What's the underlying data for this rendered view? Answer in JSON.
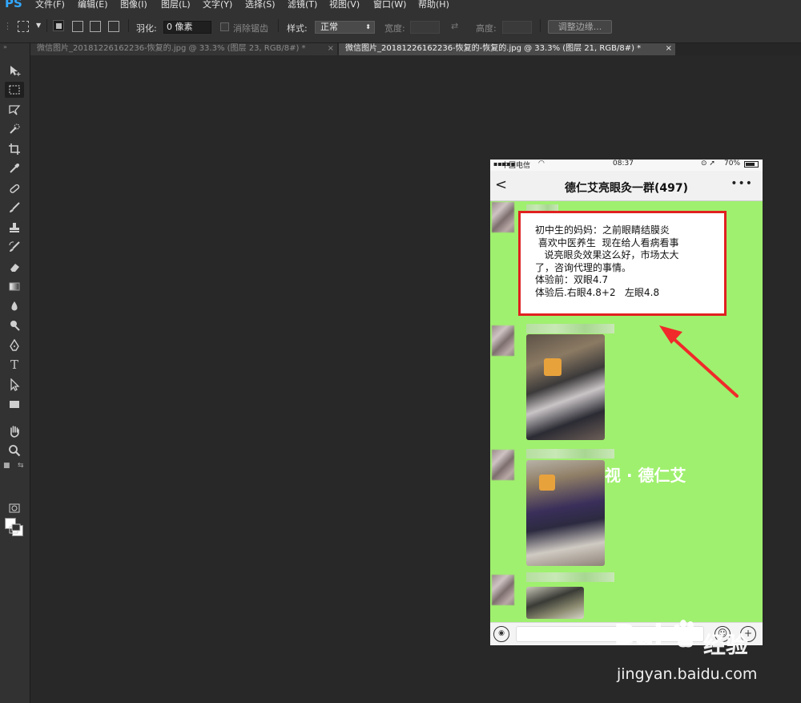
{
  "app": {
    "logo": "PS"
  },
  "menu": [
    {
      "label": "文件(F)"
    },
    {
      "label": "编辑(E)"
    },
    {
      "label": "图像(I)"
    },
    {
      "label": "图层(L)"
    },
    {
      "label": "文字(Y)"
    },
    {
      "label": "选择(S)"
    },
    {
      "label": "滤镜(T)"
    },
    {
      "label": "视图(V)"
    },
    {
      "label": "窗口(W)"
    },
    {
      "label": "帮助(H)"
    }
  ],
  "options": {
    "feather_label": "羽化:",
    "feather_value": "0 像素",
    "antialias_label": "消除锯齿",
    "style_label": "样式:",
    "style_value": "正常",
    "width_label": "宽度:",
    "height_label": "高度:",
    "refine_button": "调整边缘..."
  },
  "tabs": [
    {
      "label": "微信图片_20181226162236-恢复的.jpg @ 33.3% (图层 23, RGB/8#) *",
      "close": "×",
      "active": false
    },
    {
      "label": "微信图片_20181226162236-恢复的-恢复的.jpg @ 33.3% (图层 21, RGB/8#) *",
      "close": "×",
      "active": true
    }
  ],
  "tools": [
    {
      "name": "move-tool-icon"
    },
    {
      "name": "marquee-tool-icon"
    },
    {
      "name": "lasso-tool-icon"
    },
    {
      "name": "quick-select-tool-icon"
    },
    {
      "name": "crop-tool-icon"
    },
    {
      "name": "eyedropper-tool-icon"
    },
    {
      "name": "healing-brush-tool-icon"
    },
    {
      "name": "brush-tool-icon"
    },
    {
      "name": "clone-stamp-tool-icon"
    },
    {
      "name": "history-brush-tool-icon"
    },
    {
      "name": "eraser-tool-icon"
    },
    {
      "name": "gradient-tool-icon"
    },
    {
      "name": "blur-tool-icon"
    },
    {
      "name": "dodge-tool-icon"
    },
    {
      "name": "pen-tool-icon"
    },
    {
      "name": "type-tool-icon"
    },
    {
      "name": "path-select-tool-icon"
    },
    {
      "name": "rectangle-tool-icon"
    },
    {
      "name": "hand-tool-icon"
    },
    {
      "name": "zoom-tool-icon"
    }
  ],
  "colors": {
    "foreground": "#ffffff",
    "background": "#ffffff",
    "chat_bg": "#9ff06e",
    "highlight": "#e02020"
  },
  "phone": {
    "carrier": "中国电信",
    "time": "08:37",
    "battery": "70%",
    "chat_title": "德仁艾亮眼灸一群(497)",
    "back": "<",
    "more": "•••",
    "message_lines": [
      "初中生的妈妈：之前眼睛结膜炎",
      " 喜欢中医养生  现在给人看病看事",
      "   说亮眼灸效果这么好，市场太大",
      "了，咨询代理的事情。",
      "体验前：双眼4.7",
      "体验后.右眼4.8+2   左眼4.8"
    ],
    "overlay_text": "视 · 德仁艾"
  },
  "watermark": {
    "logo_left": "Bai",
    "logo_right": "经验",
    "url": "jingyan.baidu.com"
  }
}
